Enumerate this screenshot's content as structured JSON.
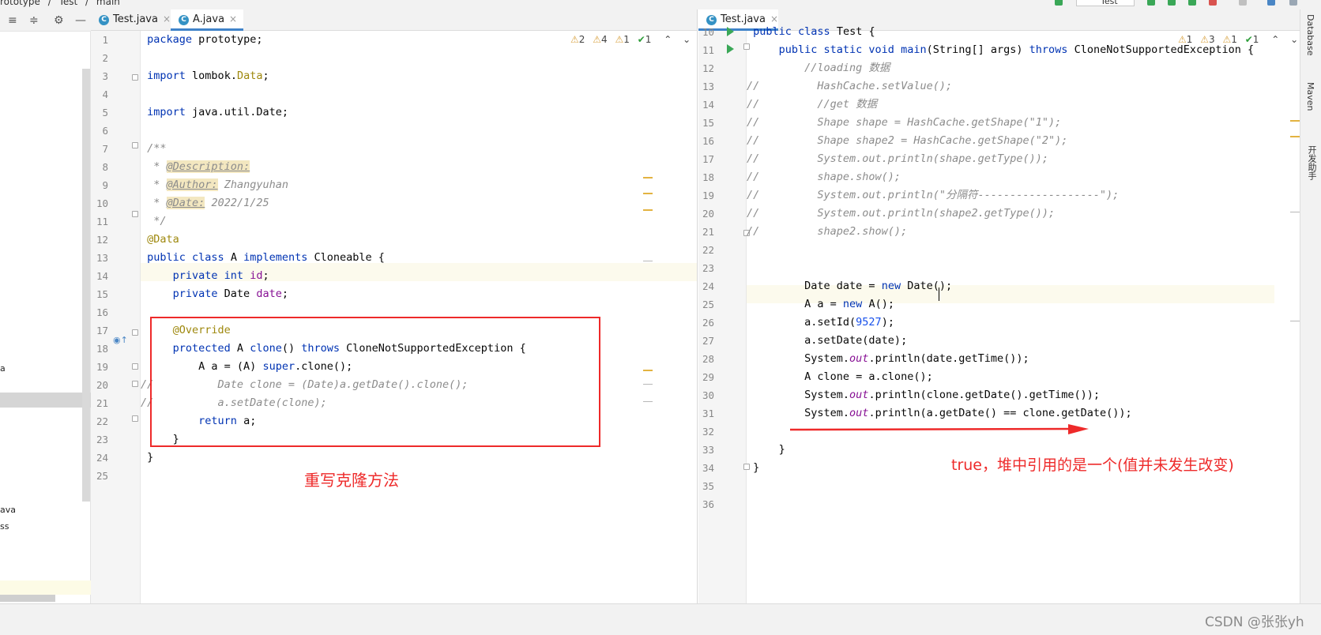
{
  "breadcrumb": [
    "rototype",
    "/",
    "Test",
    "/",
    "main"
  ],
  "run_config": "Test",
  "left_tree": [
    "a",
    "ava",
    "ss"
  ],
  "left_editor": {
    "tabs": [
      {
        "label": "Test.java",
        "close": "×"
      },
      {
        "label": "A.java",
        "close": "×"
      }
    ],
    "inspections": {
      "w1": "2",
      "w2": "4",
      "w3": "1",
      "ok": "1"
    },
    "line_numbers": [
      "1",
      "2",
      "3",
      "4",
      "5",
      "6",
      "7",
      "8",
      "9",
      "10",
      "11",
      "12",
      "13",
      "14",
      "15",
      "16",
      "17",
      "18",
      "19",
      "20",
      "21",
      "22",
      "23",
      "24",
      "25"
    ]
  },
  "right_editor": {
    "tabs": [
      {
        "label": "Test.java",
        "close": "×"
      }
    ],
    "inspections": {
      "w1": "1",
      "w2": "3",
      "w3": "1",
      "ok": "1"
    },
    "line_numbers": [
      "10",
      "11",
      "12",
      "13",
      "14",
      "15",
      "16",
      "17",
      "18",
      "19",
      "20",
      "21",
      "22",
      "23",
      "24",
      "25",
      "26",
      "27",
      "28",
      "29",
      "30",
      "31",
      "32",
      "33",
      "34",
      "35",
      "36"
    ]
  },
  "annotations": {
    "left_note": "重写克隆方法",
    "right_note": "true，堆中引用的是一个(值并未发生改变)"
  },
  "tool_windows": [
    "Database",
    "Maven",
    "开发助手"
  ],
  "watermark": "CSDN @张张yh",
  "colors": {
    "annotation_red": "#ee2a2a",
    "keyword": "#0033b3",
    "comment": "#8c8c8c"
  }
}
